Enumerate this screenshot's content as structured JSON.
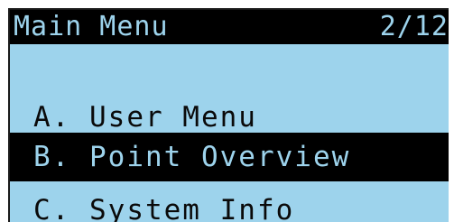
{
  "header": {
    "title": "Main Menu",
    "page_indicator": "2/12"
  },
  "menu": {
    "items": [
      {
        "label": "A. User Menu",
        "selected": false
      },
      {
        "label": "B. Point Overview",
        "selected": true
      },
      {
        "label": "C. System Info",
        "selected": false
      }
    ]
  },
  "colors": {
    "screen_background": "#9dd3ec",
    "highlight": "#000000",
    "text": "#0a0a0a"
  }
}
